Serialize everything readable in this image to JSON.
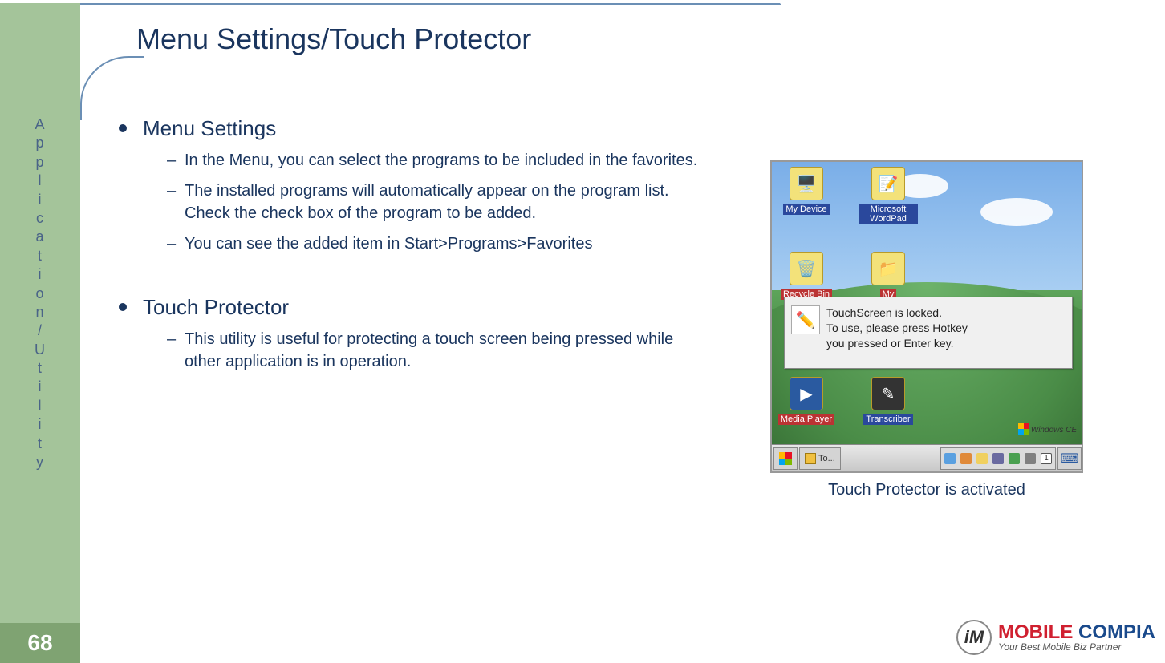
{
  "page_number": "68",
  "sidebar_label_chars": [
    "A",
    "p",
    "p",
    "l",
    "i",
    "c",
    "a",
    "t",
    "i",
    "o",
    "n",
    "/",
    "U",
    "t",
    "i",
    "l",
    "i",
    "t",
    "y"
  ],
  "title": "Menu Settings/Touch Protector",
  "sections": [
    {
      "heading": "Menu Settings",
      "items": [
        "In the Menu, you can select the programs to be included in the favorites.",
        "The installed programs will automatically appear on the program list. Check the check box of the program to be added.",
        "You can see the added item in Start>Programs>Favorites"
      ]
    },
    {
      "heading": "Touch Protector",
      "items": [
        "This utility is useful for protecting a touch screen being pressed while other application is in operation."
      ]
    }
  ],
  "screenshot": {
    "desktop_icons": {
      "my_device": "My Device",
      "wordpad": "Microsoft WordPad",
      "recycle": "Recycle Bin",
      "my": "My",
      "media_player": "Media Player",
      "transcriber": "Transcriber"
    },
    "popup": {
      "line1": "TouchScreen is locked.",
      "line2": "To use, please press Hotkey",
      "line3": "you pressed or Enter key."
    },
    "wince_label": "Windows CE",
    "taskbar_button": "To...",
    "tray_num": "1"
  },
  "caption": "Touch Protector is activated",
  "brand": {
    "badge": "iM",
    "name_a": "MOBILE ",
    "name_b": "COMPIA",
    "tagline": "Your Best Mobile Biz Partner"
  }
}
